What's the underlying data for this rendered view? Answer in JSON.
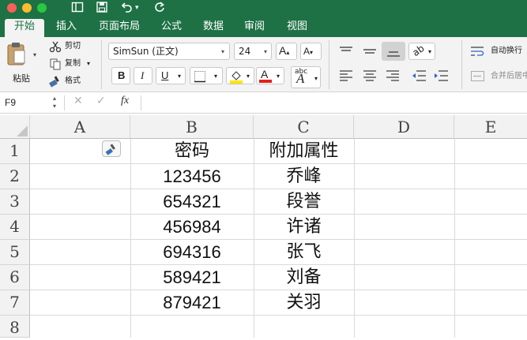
{
  "tabs": [
    "开始",
    "插入",
    "页面布局",
    "公式",
    "数据",
    "审阅",
    "视图"
  ],
  "clipboard": {
    "paste": "粘贴",
    "cut": "剪切",
    "copy": "复制",
    "format": "格式"
  },
  "font": {
    "name": "SimSun (正文)",
    "size": "24"
  },
  "alignment": {
    "wrap": "自动换行",
    "merge": "合并后居中"
  },
  "formula_bar": {
    "name_box": "F9",
    "fx": "fx",
    "value": ""
  },
  "columns": [
    "A",
    "B",
    "C",
    "D",
    "E"
  ],
  "rows": [
    "1",
    "2",
    "3",
    "4",
    "5",
    "6",
    "7",
    "8"
  ],
  "table": {
    "headers": [
      "密码",
      "附加属性"
    ],
    "data": [
      [
        "123456",
        "乔峰"
      ],
      [
        "654321",
        "段誉"
      ],
      [
        "456984",
        "许诸"
      ],
      [
        "694316",
        "张飞"
      ],
      [
        "589421",
        "刘备"
      ],
      [
        "879421",
        "关羽"
      ]
    ]
  },
  "colors": {
    "accent": "#1e7145",
    "ribbon": "#f3f3f3"
  }
}
